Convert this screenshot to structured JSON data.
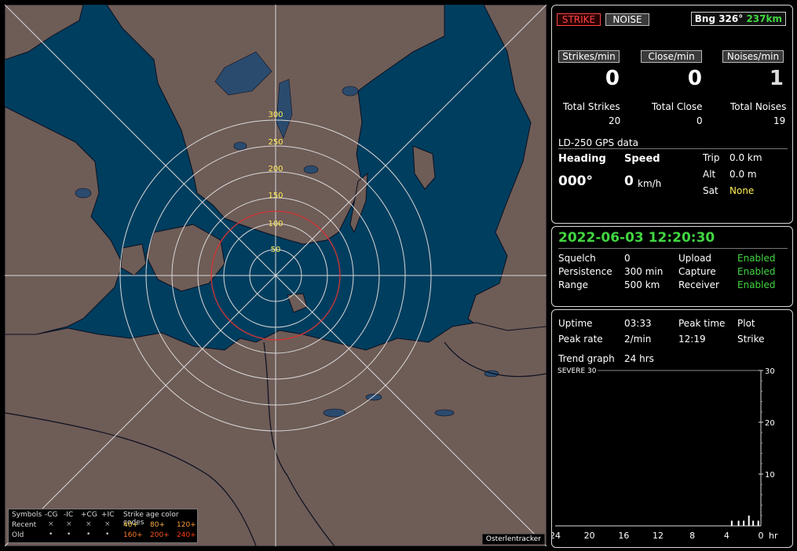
{
  "map": {
    "range_labels": [
      "50",
      "100",
      "150",
      "200",
      "250",
      "300"
    ],
    "credit": "Osterlentracker",
    "colors": {
      "sea": "#003e5f",
      "land": "#6e5c57",
      "lake": "#2b4b6e",
      "border": "#0b1020",
      "grid": "#d8d8d8",
      "close_ring": "#d43535",
      "label": "#ffee55"
    }
  },
  "legend": {
    "symbols_label": "Symbols",
    "types": [
      "-CG",
      "-IC",
      "+CG",
      "+IC"
    ],
    "age_label": "Strike age color codes",
    "recent_label": "Recent",
    "old_label": "Old",
    "recent_symbol": "×",
    "old_symbol": "•",
    "recent_ages": [
      "40+",
      "80+",
      "120+"
    ],
    "old_ages": [
      "160+",
      "200+",
      "240+"
    ]
  },
  "status": {
    "strike_label": "STRIKE",
    "noise_label": "NOISE",
    "bearing": "Bng 326°",
    "distance": "237km"
  },
  "counters": {
    "strikes_label": "Strikes/min",
    "close_label": "Close/min",
    "noises_label": "Noises/min",
    "strikes_per_min": "0",
    "close_per_min": "0",
    "noises_per_min": "1",
    "total_strikes_label": "Total Strikes",
    "total_close_label": "Total Close",
    "total_noises_label": "Total Noises",
    "total_strikes": "20",
    "total_close": "0",
    "total_noises": "19"
  },
  "gps": {
    "title": "LD-250 GPS data",
    "heading_label": "Heading",
    "speed_label": "Speed",
    "heading": "000°",
    "speed": "0",
    "speed_unit": "km/h",
    "trip_label": "Trip",
    "trip": "0.0 km",
    "alt_label": "Alt",
    "alt": "0.0 m",
    "sat_label": "Sat",
    "sat": "None"
  },
  "settings": {
    "datetime": "2022-06-03 12:20:30",
    "squelch_label": "Squelch",
    "squelch": "0",
    "persistence_label": "Persistence",
    "persistence": "300 min",
    "range_label": "Range",
    "range": "500 km",
    "upload_label": "Upload",
    "upload": "Enabled",
    "capture_label": "Capture",
    "capture": "Enabled",
    "receiver_label": "Receiver",
    "receiver": "Enabled"
  },
  "stats": {
    "uptime_label": "Uptime",
    "uptime": "03:33",
    "peak_time_label": "Peak time",
    "peak_time": "12:19",
    "plot_label": "Plot",
    "plot": "Strike",
    "peak_rate_label": "Peak rate",
    "peak_rate": "2/min",
    "trend_label": "Trend graph",
    "trend_span": "24 hrs"
  },
  "trend": {
    "severe_label": "SEVERE 30",
    "y_ticks": [
      "30",
      "20",
      "10"
    ],
    "x_ticks": [
      "24",
      "20",
      "16",
      "12",
      "8",
      "4",
      "0"
    ],
    "x_unit": "hr"
  },
  "chart_data": {
    "type": "bar",
    "title": "",
    "xlabel": "hr",
    "ylabel": "",
    "x_range": [
      24,
      0
    ],
    "ylim": [
      0,
      30
    ],
    "x": [
      3.4,
      2.6,
      2.0,
      1.4,
      0.9,
      0.3
    ],
    "values": [
      1,
      1,
      1,
      2,
      1,
      1
    ]
  }
}
